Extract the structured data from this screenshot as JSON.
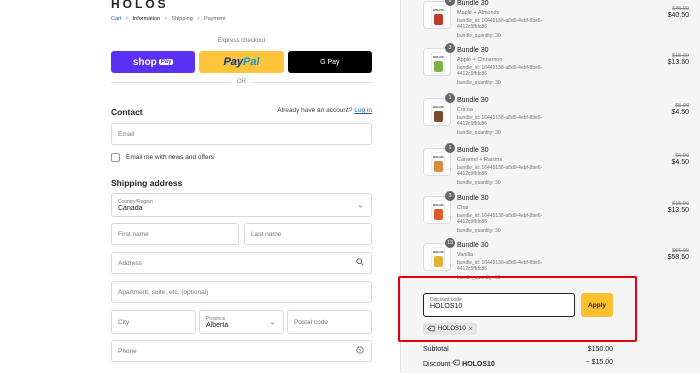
{
  "brand": "HOLOS",
  "breadcrumb": {
    "cart": "Cart",
    "information": "Information",
    "shipping": "Shipping",
    "payment": "Payment",
    "separator": ">"
  },
  "express": {
    "label": "Express checkout",
    "shop_pay": "shop",
    "shop_pay_badge": "Pay",
    "paypal_a": "Pay",
    "paypal_b": "Pal",
    "gpay": "G Pay",
    "or": "OR"
  },
  "contact": {
    "title": "Contact",
    "account_prompt": "Already have an account?",
    "login": "Log in",
    "email_placeholder": "Email",
    "newsletter": "Email me with news and offers"
  },
  "shipping": {
    "title": "Shipping address",
    "country_label": "Country/Region",
    "country_value": "Canada",
    "first_name": "First name",
    "last_name": "Last name",
    "address": "Address",
    "apartment": "Apartment, suite, etc. (optional)",
    "city": "City",
    "province_label": "Province",
    "province_value": "Alberta",
    "postal": "Postal code",
    "phone": "Phone"
  },
  "cart": {
    "items": [
      {
        "qty": "9",
        "name": "Bundle 30",
        "variant": "Maple + Almonds",
        "bundle_id": "bundle_id: 16449138-a8d9-4ebf-8be6-4412c9ffdc86",
        "bundle_qty": "bundle_quantity: 30",
        "old_price": "$45.00",
        "new_price": "$40.50",
        "color": "#c0392b"
      },
      {
        "qty": "3",
        "name": "Bundle 30",
        "variant": "Apple + Cinnamon",
        "bundle_id": "bundle_id: 16449138-a8d9-4ebf-8be6-4412c9ffdc86",
        "bundle_qty": "bundle_quantity: 30",
        "old_price": "$15.00",
        "new_price": "$13.50",
        "color": "#7fb34a"
      },
      {
        "qty": "1",
        "name": "Bundle 30",
        "variant": "Cocoa",
        "bundle_id": "bundle_id: 16449138-a8d9-4ebf-8be6-4412c9ffdc86",
        "bundle_qty": "bundle_quantity: 30",
        "old_price": "$5.00",
        "new_price": "$4.50",
        "color": "#7b4a2e"
      },
      {
        "qty": "1",
        "name": "Bundle 30",
        "variant": "Caramel + Raisins",
        "bundle_id": "bundle_id: 16449138-a8d9-4ebf-8be6-4412c9ffdc86",
        "bundle_qty": "bundle_quantity: 30",
        "old_price": "$5.00",
        "new_price": "$4.50",
        "color": "#d98b3a"
      },
      {
        "qty": "3",
        "name": "Bundle 30",
        "variant": "Chai",
        "bundle_id": "bundle_id: 16449138-a8d9-4ebf-8be6-4412c9ffdc86",
        "bundle_qty": "bundle_quantity: 30",
        "old_price": "$15.00",
        "new_price": "$13.50",
        "color": "#e05a2b"
      },
      {
        "qty": "13",
        "name": "Bundle 30",
        "variant": "Vanilla",
        "bundle_id": "bundle_id: 16449138-a8d9-4ebf-8be6-4412c9ffdc86",
        "bundle_qty": "bundle_quantity: 30",
        "old_price": "$65.00",
        "new_price": "$58.50",
        "color": "#e0b43a"
      }
    ]
  },
  "discount": {
    "label": "Discount code",
    "value": "HOLOS10",
    "apply": "Apply",
    "tag": "HOLOS10",
    "tag_remove": "×"
  },
  "summary": {
    "subtotal_label": "Subtotal",
    "subtotal_value": "$150.00",
    "discount_label": "Discount",
    "discount_code": "HOLOS10",
    "discount_value": "− $15.00"
  },
  "colors": {
    "shop_pay": "#5a31f4",
    "paypal": "#ffc439",
    "apply": "#fbc02d",
    "highlight": "#e3000f"
  }
}
